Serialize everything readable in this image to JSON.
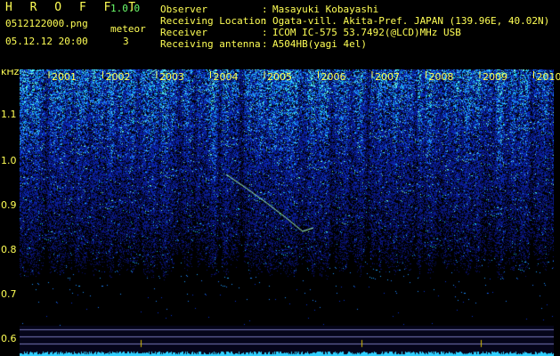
{
  "header": {
    "app_title": "H R O F F T",
    "app_version": "1.0.0",
    "file_name": "0512122000.png",
    "timestamp": "05.12.12 20:00",
    "meteor_label": "meteor",
    "meteor_count": "3"
  },
  "info": [
    {
      "key": "Observer",
      "value": "Masayuki Kobayashi"
    },
    {
      "key": "Receiving Location",
      "value": "Ogata-vill. Akita-Pref. JAPAN (139.96E, 40.02N)"
    },
    {
      "key": "Receiver",
      "value": "ICOM IC-575 53.7492(@LCD)MHz USB"
    },
    {
      "key": "Receiving antenna",
      "value": "A504HB(yagi 4el)"
    }
  ],
  "info_colon": ":",
  "spectrogram": {
    "y_unit": "kHz",
    "y_ticks": [
      "1.1",
      "1.0",
      "0.9",
      "0.8",
      "0.7",
      "0.6"
    ],
    "time_labels": [
      "2001",
      "2002",
      "2003",
      "2004",
      "2005",
      "2006",
      "2007",
      "2008",
      "2009",
      "2010"
    ],
    "colors": {
      "background": "#000000",
      "signal_low": "#1a2a9a",
      "signal_high": "#40d0ff",
      "text": "#ffff55",
      "trace": "#aaffaa"
    }
  }
}
